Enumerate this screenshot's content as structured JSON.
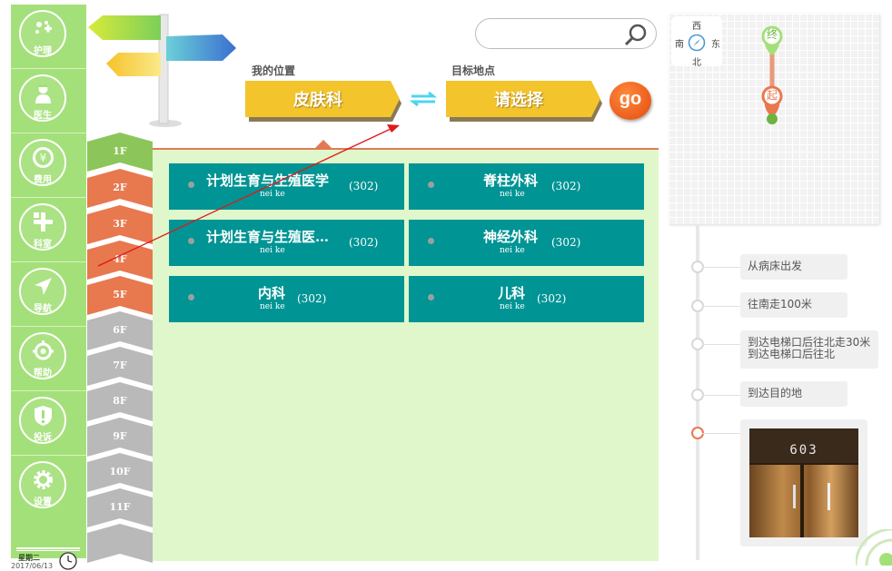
{
  "sidebar": {
    "items": [
      {
        "label": "护理",
        "icon": "care-icon"
      },
      {
        "label": "医生",
        "icon": "doctor-icon"
      },
      {
        "label": "费用",
        "icon": "cost-icon"
      },
      {
        "label": "科室",
        "icon": "department-icon"
      },
      {
        "label": "导航",
        "icon": "navigation-icon"
      },
      {
        "label": "帮助",
        "icon": "help-icon"
      },
      {
        "label": "投诉",
        "icon": "complaint-icon"
      },
      {
        "label": "设置",
        "icon": "settings-icon"
      }
    ],
    "weekday": "星期二",
    "date": "2017/06/13"
  },
  "header": {
    "my_location_title": "我的位置",
    "my_location": "皮肤科",
    "target_title": "目标地点",
    "target": "请选择",
    "go_label": "go"
  },
  "search": {
    "placeholder": "",
    "value": ""
  },
  "floors": [
    "1F",
    "2F",
    "3F",
    "4F",
    "5F",
    "6F",
    "7F",
    "8F",
    "9F",
    "10F",
    "11F"
  ],
  "departments": [
    {
      "name": "计划生育与生殖医学",
      "sub": "nei ke",
      "count": "(302)"
    },
    {
      "name": "脊柱外科",
      "sub": "nei ke",
      "count": "(302)"
    },
    {
      "name": "计划生育与生殖医…",
      "sub": "nei ke",
      "count": "(302)"
    },
    {
      "name": "神经外科",
      "sub": "nei ke",
      "count": "(302)"
    },
    {
      "name": "内科",
      "sub": "nei ke",
      "count": "(302)"
    },
    {
      "name": "儿科",
      "sub": "nei ke",
      "count": "(302)"
    }
  ],
  "map": {
    "compass": {
      "west": "西",
      "south": "南",
      "east": "东",
      "north": "北"
    },
    "end_label": "终",
    "start_label": "起"
  },
  "route_steps": [
    {
      "text": "从病床出发"
    },
    {
      "text": "往南走100米"
    },
    {
      "text": "到达电梯口后往北走30米 到达电梯口后往北"
    },
    {
      "text": "到达目的地"
    }
  ],
  "photo": {
    "room_number": "603"
  },
  "colors": {
    "sidebar": "#a4e07a",
    "dept_tile": "#009494",
    "content_bg": "#dff7cb",
    "floor_active": "#e8784e",
    "floor_green": "#8cc65a",
    "floor_gray": "#b9b9b9",
    "location_box": "#f3c42b"
  }
}
